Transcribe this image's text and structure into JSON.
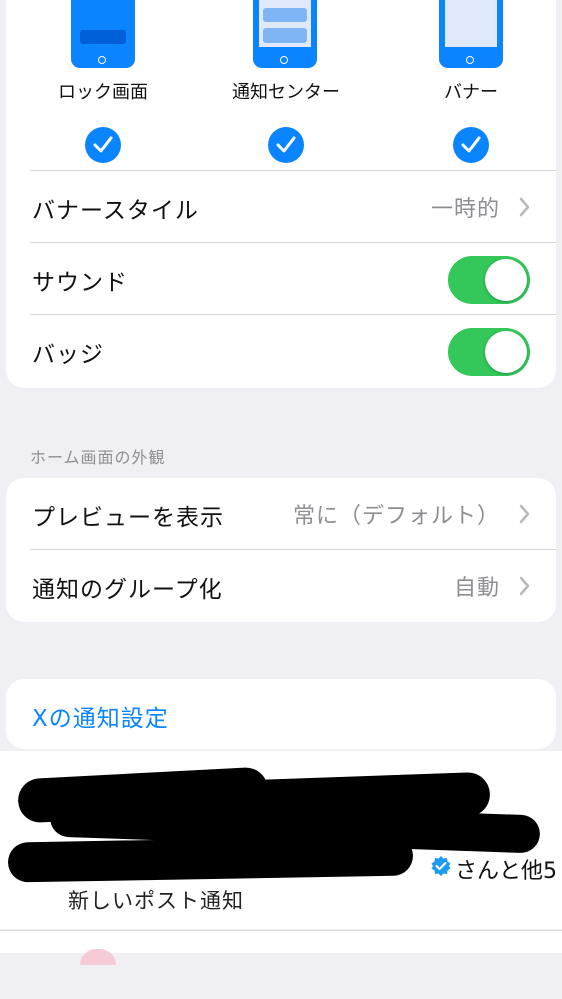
{
  "styles": {
    "lock_screen": "ロック画面",
    "notification_center": "通知センター",
    "banner": "バナー"
  },
  "alert_rows": {
    "banner_style_label": "バナースタイル",
    "banner_style_value": "一時的",
    "sound_label": "サウンド",
    "sound_on": true,
    "badge_label": "バッジ",
    "badge_on": true
  },
  "home_screen": {
    "header": "ホーム画面の外観",
    "preview_label": "プレビューを表示",
    "preview_value": "常に（デフォルト）",
    "grouping_label": "通知のグループ化",
    "grouping_value": "自動"
  },
  "app_link": "Xの通知設定",
  "notification": {
    "suffix": "さんと他5",
    "text": "新しいポスト通知"
  },
  "colors": {
    "accent": "#0a84ff",
    "toggle_on": "#34c759"
  }
}
